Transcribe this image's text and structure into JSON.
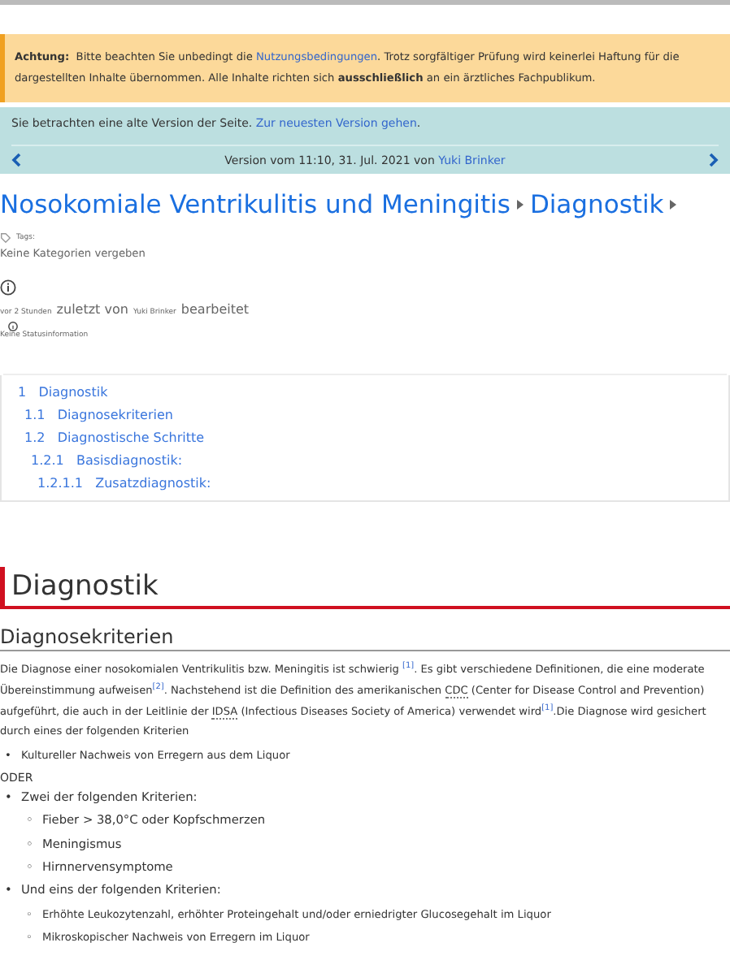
{
  "notice": {
    "label": "Achtung:",
    "before": "Bitte beachten Sie unbedingt die",
    "link": "Nutzungsbedingungen",
    "after": ". Trotz sorgfältiger Prüfung wird keinerlei Haftung für die dargestellten Inhalte übernommen. Alle Inhalte richten sich **ausschließlich** an ein ärztliches Fachpublikum."
  },
  "old_version": {
    "text": "Sie betrachten eine alte Version der Seite.",
    "link": "Zur neuesten Version gehen",
    "after": ".",
    "version": "Version vom 11:10, 31. Jul. 2021 von",
    "author": "Yuki Brinker"
  },
  "breadcrumbs": [
    "Nosokomiale Ventrikulitis und Meningitis",
    "Diagnostik"
  ],
  "tags": {
    "label": "Tags:",
    "text": "Keine Kategorien vergeben"
  },
  "edited": {
    "time": "vor 2 Stunden",
    "middle": "zuletzt von",
    "author": "Yuki Brinker",
    "end": "bearbeitet"
  },
  "status": "Keine Statusinformation",
  "toc": [
    {
      "number": "1",
      "label": "Diagnostik",
      "children": [
        {
          "number": "1.1",
          "label": "Diagnosekriterien"
        },
        {
          "number": "1.2",
          "label": "Diagnostische Schritte",
          "children": [
            {
              "number": "1.2.1",
              "label": "Basisdiagnostik:",
              "children": [
                {
                  "number": "1.2.1.1",
                  "label": "Zusatzdiagnostik:"
                }
              ]
            }
          ]
        }
      ]
    }
  ],
  "heading": "Diagnostik",
  "subheading": "Diagnosekriterien",
  "paragraph": [
    {
      "kind": "text",
      "text": "Die Diagnose einer nosokomialen Ventrikulitis bzw. Meningitis ist schwierig "
    },
    {
      "kind": "ref",
      "text": "[1]"
    },
    {
      "kind": "text",
      "text": ". Es gibt verschiedene Definitionen, die eine moderate Übereinstimmung aufweisen"
    },
    {
      "kind": "ref",
      "text": "[2]"
    },
    {
      "kind": "text",
      "text": ". Nachstehend ist die Definition des amerikanischen "
    },
    {
      "kind": "abbr",
      "text": "CDC"
    },
    {
      "kind": "text",
      "text": " (Center for Disease Control and Prevention) aufgeführt, die auch in der Leitlinie der "
    },
    {
      "kind": "abbr",
      "text": "IDSA"
    },
    {
      "kind": "text",
      "text": " (Infectious Diseases Society of America) verwendet wird"
    },
    {
      "kind": "ref",
      "text": "[1]"
    },
    {
      "kind": "text",
      "text": ".Die Diagnose wird gesichert durch eines der folgenden Kriterien"
    }
  ],
  "list1": [
    {
      "marker": "•",
      "text": "Kultureller Nachweis von Erregern aus dem Liquor"
    }
  ],
  "or": "ODER",
  "list2": [
    {
      "marker": "•",
      "text": "Zwei der folgenden Kriterien:",
      "children": [
        {
          "marker": "◦",
          "text": "Fieber > 38,0°C oder Kopfschmerzen"
        },
        {
          "marker": "◦",
          "text": "Meningismus"
        },
        {
          "marker": "◦",
          "text": "Hirnnervensymptome"
        }
      ]
    },
    {
      "marker": "•",
      "text": "Und eins der folgenden Kriterien:",
      "children": [
        {
          "marker": "◦",
          "text": "Erhöhte Leukozytenzahl, erhöhter Proteingehalt und/oder erniedrigter Glucosegehalt im Liquor"
        },
        {
          "marker": "◦",
          "text": "Mikroskopischer Nachweis von Erregern im Liquor"
        }
      ]
    }
  ]
}
